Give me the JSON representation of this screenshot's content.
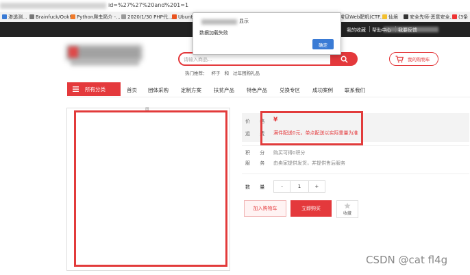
{
  "browser": {
    "url": "id=%27%27%20and%201=1",
    "bookmarks": [
      {
        "label": "渗透测..."
      },
      {
        "label": "Brainfuck/Ook!"
      },
      {
        "label": "Python爬虫简介 -..."
      },
      {
        "label": "2020/1/30 PHP代..."
      },
      {
        "label": "Ubuntu"
      },
      {
        "label": "常见Web靶机(CTF..."
      },
      {
        "label": "仙境"
      },
      {
        "label": "安全先师-恶意安全..."
      },
      {
        "label": "(3条"
      }
    ]
  },
  "topnav": {
    "items": [
      "我的收藏",
      "帮助中心",
      "我要反馈"
    ]
  },
  "header": {
    "search_placeholder": "请输入商品...",
    "hot_label": "热门推荐：",
    "hot_items": [
      "杯子",
      "和",
      "过年团购礼品"
    ],
    "cart_label": "我的购物车"
  },
  "nav": {
    "category_label": "所有分类",
    "items": [
      "首页",
      "团体采购",
      "定制方案",
      "扶贫产品",
      "特色产品",
      "兑换专区",
      "成功案例",
      "联系我们"
    ]
  },
  "product": {
    "price_label": "价  格",
    "price_symbol": "¥",
    "shipping_label": "运  费",
    "shipping_text": "满件配送0元，单点配送以实际重量为准",
    "points_label": "积  分",
    "points_text": "购买可得0积分",
    "service_label": "服  务",
    "service_text": "由卖家提供发货，并提供售后服务",
    "qty_label": "数  量",
    "qty_minus": "-",
    "qty_value": "1",
    "qty_plus": "+",
    "add_cart": "加入购物车",
    "buy_now": "立即购买",
    "favorite": "收藏"
  },
  "dialog": {
    "title": "显示",
    "message": "数据加载失败",
    "ok": "确定"
  },
  "watermark": "CSDN @cat fl4g",
  "colors": {
    "accent": "#e4393c",
    "highlight": "#e23b3b",
    "dialog_button": "#3a7bd5"
  }
}
